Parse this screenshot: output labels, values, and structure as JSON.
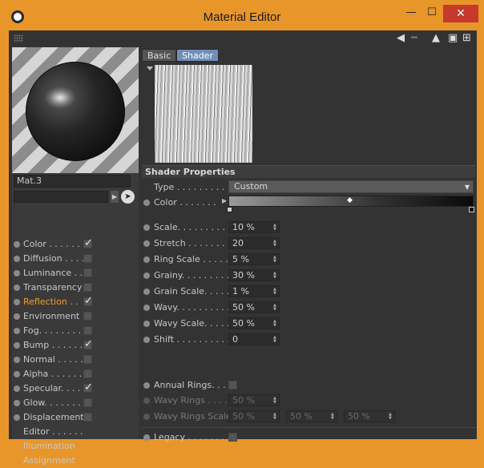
{
  "window": {
    "title": "Material Editor",
    "minimize": "—",
    "maximize": "☐",
    "close": "✕"
  },
  "material": {
    "name": "Mat.3"
  },
  "channels": [
    {
      "label": "Color . . . . . .",
      "checked": true
    },
    {
      "label": "Diffusion . . . .",
      "checked": false
    },
    {
      "label": "Luminance . .",
      "checked": false
    },
    {
      "label": "Transparency",
      "checked": false
    },
    {
      "label": "Reflection . .",
      "checked": true,
      "active": true
    },
    {
      "label": "Environment",
      "checked": false
    },
    {
      "label": "Fog. . . . . . . .",
      "checked": false
    },
    {
      "label": "Bump . . . . . .",
      "checked": true
    },
    {
      "label": "Normal . . . . .",
      "checked": false
    },
    {
      "label": "Alpha . . . . . .",
      "checked": false
    },
    {
      "label": "Specular. . . .",
      "checked": true
    },
    {
      "label": "Glow. . . . . . .",
      "checked": false
    },
    {
      "label": "Displacement",
      "checked": false
    },
    {
      "label": "Editor . . . . . ."
    },
    {
      "label": "Illumination"
    },
    {
      "label": "Assignment"
    }
  ],
  "tabs": [
    {
      "label": "Basic",
      "active": false
    },
    {
      "label": "Shader",
      "active": true
    }
  ],
  "shader": {
    "section_title": "Shader Properties",
    "type_label": "Type . . . . . . . . . .",
    "type_value": "Custom",
    "color_label": "Color . . . . . . .",
    "params": [
      {
        "label": "Scale. . . . . . . . . .",
        "value": "10 %"
      },
      {
        "label": "Stretch . . . . . . . .",
        "value": "20"
      },
      {
        "label": "Ring Scale . . . . .",
        "value": "5 %"
      },
      {
        "label": "Grainy. . . . . . . . .",
        "value": "30 %"
      },
      {
        "label": "Grain Scale. . . . .",
        "value": "1 %"
      },
      {
        "label": "Wavy. . . . . . . . . .",
        "value": "50 %"
      },
      {
        "label": "Wavy Scale. . . . .",
        "value": "50 %"
      },
      {
        "label": "Shift . . . . . . . . . .",
        "value": "0"
      }
    ],
    "annual_rings_label": "Annual Rings. . .",
    "wavy_rings_label": "Wavy Rings . . . .",
    "wavy_rings_value": "50 %",
    "wavy_rings_scale_label": "Wavy Rings Scale",
    "wavy_rings_scale_values": [
      "50 %",
      "50 %",
      "50 %"
    ],
    "legacy_label": "Legacy . . . . . . . ."
  }
}
